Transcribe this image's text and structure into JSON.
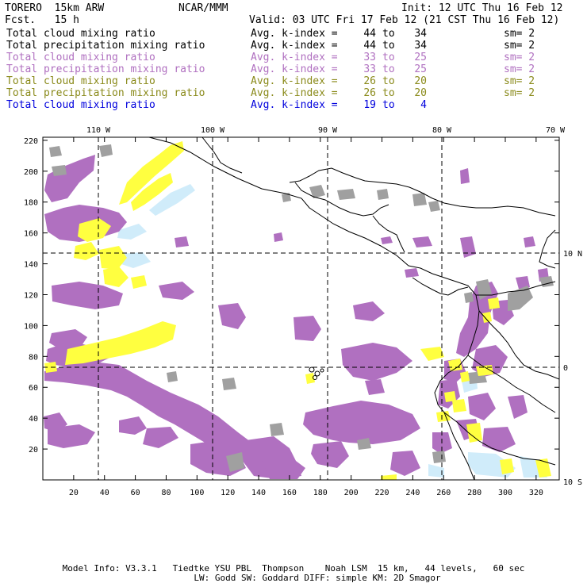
{
  "header": {
    "model": "TORERO  15km ARW",
    "org": "NCAR/MMM",
    "init": "Init: 12 UTC Thu 16 Feb 12",
    "fcst": "Fcst.   15 h",
    "valid": "Valid: 03 UTC Fri 17 Feb 12 (21 CST Thu 16 Feb 12)"
  },
  "legend": [
    {
      "name": "Total cloud mixing ratio",
      "avg": "Avg. k-index =",
      "v1": "44",
      "to": "to",
      "v2": "34",
      "sm": "sm= 2",
      "color": "#000000"
    },
    {
      "name": "Total precipitation mixing ratio",
      "avg": "Avg. k-index =",
      "v1": "44",
      "to": "to",
      "v2": "34",
      "sm": "sm= 2",
      "color": "#000000"
    },
    {
      "name": "Total cloud mixing ratio",
      "avg": "Avg. k-index =",
      "v1": "33",
      "to": "to",
      "v2": "25",
      "sm": "sm= 2",
      "color": "#b070c0"
    },
    {
      "name": "Total precipitation mixing ratio",
      "avg": "Avg. k-index =",
      "v1": "33",
      "to": "to",
      "v2": "25",
      "sm": "sm= 2",
      "color": "#b070c0"
    },
    {
      "name": "Total cloud mixing ratio",
      "avg": "Avg. k-index =",
      "v1": "26",
      "to": "to",
      "v2": "20",
      "sm": "sm= 2",
      "color": "#8a8a1a"
    },
    {
      "name": "Total precipitation mixing ratio",
      "avg": "Avg. k-index =",
      "v1": "26",
      "to": "to",
      "v2": "20",
      "sm": "sm= 2",
      "color": "#8a8a1a"
    },
    {
      "name": "Total cloud mixing ratio",
      "avg": "Avg. k-index =",
      "v1": "19",
      "to": "to",
      "v2": "4",
      "sm": "",
      "color": "#0000dd"
    }
  ],
  "axes": {
    "top_lon_labels": [
      "110 W",
      "100 W",
      "90 W",
      "80 W",
      "70 W"
    ],
    "right_lat_labels": [
      "10 N",
      "0",
      "10 S"
    ],
    "left_ticks": [
      "220",
      "200",
      "180",
      "160",
      "140",
      "120",
      "100",
      "80",
      "60",
      "40",
      "20"
    ],
    "bottom_ticks": [
      "20",
      "40",
      "60",
      "80",
      "100",
      "120",
      "140",
      "160",
      "180",
      "200",
      "220",
      "240",
      "260",
      "280",
      "300",
      "320"
    ]
  },
  "footer": {
    "line1": "Model Info: V3.3.1   Tiedtke YSU PBL  Thompson    Noah LSM  15 km,   44 levels,   60 sec",
    "line2": "LW: Godd SW: Goddard DIFF: simple KM: 2D Smagor"
  },
  "colors": {
    "purple": "#b070c0",
    "gray": "#a0a0a0",
    "yellow": "#ffff40",
    "lightblue": "#d0ecfa"
  }
}
